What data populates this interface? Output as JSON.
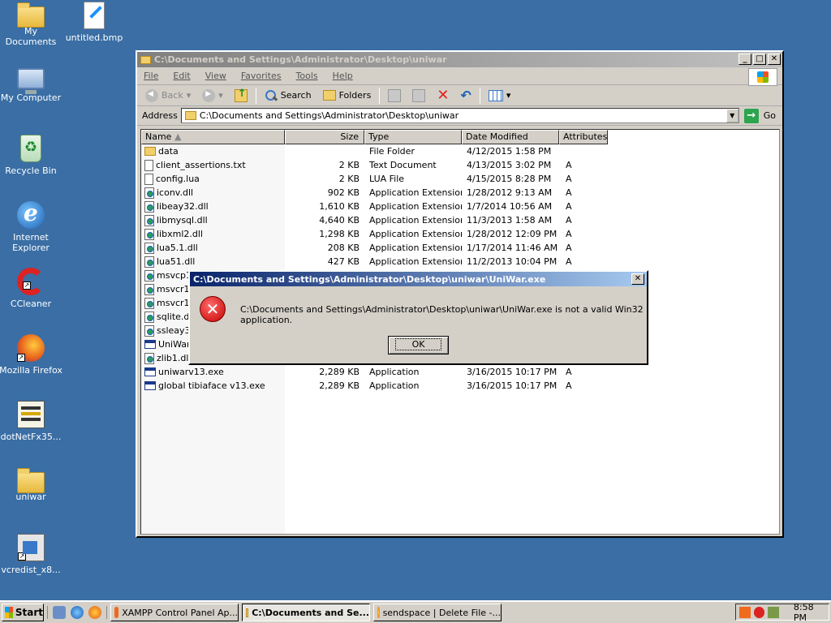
{
  "desktop": {
    "icons": [
      {
        "label": "My Documents"
      },
      {
        "label": "untitled.bmp"
      },
      {
        "label": "My Computer"
      },
      {
        "label": "Recycle Bin"
      },
      {
        "label": "Internet\nExplorer"
      },
      {
        "label": "CCleaner"
      },
      {
        "label": "Mozilla Firefox"
      },
      {
        "label": "dotNetFx35..."
      },
      {
        "label": "uniwar"
      },
      {
        "label": "vcredist_x8..."
      }
    ]
  },
  "explorer": {
    "title": "C:\\Documents and Settings\\Administrator\\Desktop\\uniwar",
    "menu": [
      "File",
      "Edit",
      "View",
      "Favorites",
      "Tools",
      "Help"
    ],
    "toolbar": {
      "back": "Back",
      "search": "Search",
      "folders": "Folders"
    },
    "address": {
      "label": "Address",
      "value": "C:\\Documents and Settings\\Administrator\\Desktop\\uniwar",
      "go": "Go"
    },
    "columns": [
      "Name",
      "Size",
      "Type",
      "Date Modified",
      "Attributes"
    ],
    "files": [
      {
        "name": "data",
        "size": "",
        "type": "File Folder",
        "date": "4/12/2015 1:58 PM",
        "attr": "",
        "icon": "folder"
      },
      {
        "name": "client_assertions.txt",
        "size": "2 KB",
        "type": "Text Document",
        "date": "4/13/2015 3:02 PM",
        "attr": "A",
        "icon": "txt"
      },
      {
        "name": "config.lua",
        "size": "2 KB",
        "type": "LUA File",
        "date": "4/15/2015 8:28 PM",
        "attr": "A",
        "icon": "lua"
      },
      {
        "name": "iconv.dll",
        "size": "902 KB",
        "type": "Application Extension",
        "date": "1/28/2012 9:13 AM",
        "attr": "A",
        "icon": "dll"
      },
      {
        "name": "libeay32.dll",
        "size": "1,610 KB",
        "type": "Application Extension",
        "date": "1/7/2014 10:56 AM",
        "attr": "A",
        "icon": "dll"
      },
      {
        "name": "libmysql.dll",
        "size": "4,640 KB",
        "type": "Application Extension",
        "date": "11/3/2013 1:58 AM",
        "attr": "A",
        "icon": "dll"
      },
      {
        "name": "libxml2.dll",
        "size": "1,298 KB",
        "type": "Application Extension",
        "date": "1/28/2012 12:09 PM",
        "attr": "A",
        "icon": "dll"
      },
      {
        "name": "lua5.1.dll",
        "size": "208 KB",
        "type": "Application Extension",
        "date": "1/17/2014 11:46 AM",
        "attr": "A",
        "icon": "dll"
      },
      {
        "name": "lua51.dll",
        "size": "427 KB",
        "type": "Application Extension",
        "date": "11/2/2013 10:04 PM",
        "attr": "A",
        "icon": "dll"
      },
      {
        "name": "msvcp1",
        "size": "",
        "type": "",
        "date": "",
        "attr": "",
        "icon": "dll"
      },
      {
        "name": "msvcr10",
        "size": "",
        "type": "",
        "date": "",
        "attr": "",
        "icon": "dll"
      },
      {
        "name": "msvcr12",
        "size": "",
        "type": "",
        "date": "",
        "attr": "",
        "icon": "dll"
      },
      {
        "name": "sqlite.dl",
        "size": "",
        "type": "",
        "date": "",
        "attr": "",
        "icon": "dll"
      },
      {
        "name": "ssleay3",
        "size": "",
        "type": "",
        "date": "",
        "attr": "",
        "icon": "dll"
      },
      {
        "name": "UniWar",
        "size": "",
        "type": "",
        "date": "",
        "attr": "",
        "icon": "exe"
      },
      {
        "name": "zlib1.dll",
        "size": "",
        "type": "",
        "date": "",
        "attr": "",
        "icon": "dll"
      },
      {
        "name": "uniwarv13.exe",
        "size": "2,289 KB",
        "type": "Application",
        "date": "3/16/2015 10:17 PM",
        "attr": "A",
        "icon": "exe"
      },
      {
        "name": "global tibiaface v13.exe",
        "size": "2,289 KB",
        "type": "Application",
        "date": "3/16/2015 10:17 PM",
        "attr": "A",
        "icon": "exe"
      }
    ]
  },
  "dialog": {
    "title": "C:\\Documents and Settings\\Administrator\\Desktop\\uniwar\\UniWar.exe",
    "message": "C:\\Documents and Settings\\Administrator\\Desktop\\uniwar\\UniWar.exe is not a valid Win32 application.",
    "ok": "OK",
    "icon": "error-icon"
  },
  "taskbar": {
    "start": "Start",
    "tasks": [
      {
        "label": "XAMPP Control Panel Ap..."
      },
      {
        "label": "C:\\Documents and Se..."
      },
      {
        "label": "sendspace | Delete File -..."
      }
    ],
    "clock": "8:58 PM"
  }
}
